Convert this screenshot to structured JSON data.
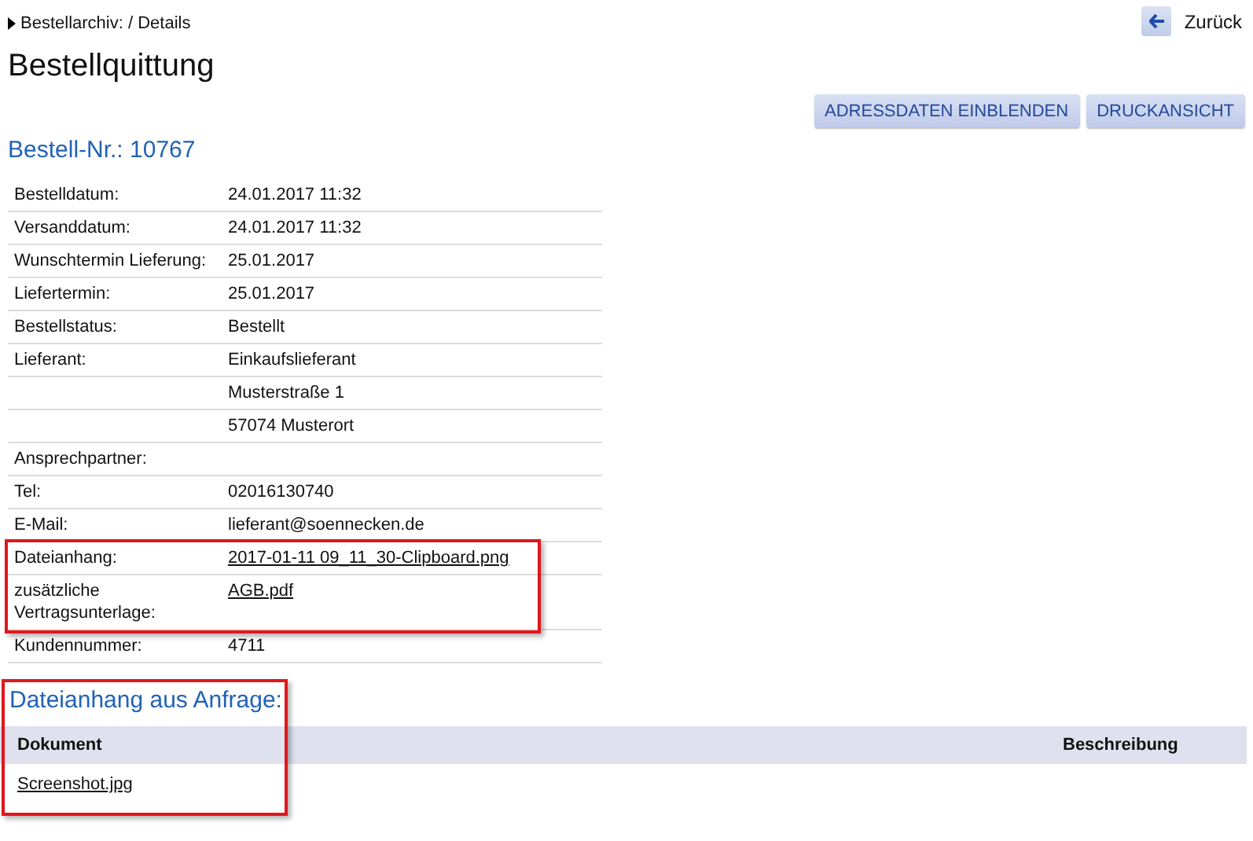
{
  "breadcrumb": "Bestellarchiv: / Details",
  "back_link": "Zurück",
  "title": "Bestellquittung",
  "buttons": [
    "ADRESSDATEN EINBLENDEN",
    "DRUCKANSICHT"
  ],
  "order_heading": "Bestell-Nr.: 10767",
  "details": [
    {
      "label": "Bestelldatum:",
      "value": "24.01.2017 11:32"
    },
    {
      "label": "Versanddatum:",
      "value": "24.01.2017 11:32"
    },
    {
      "label": "Wunschtermin Lieferung:",
      "value": "25.01.2017"
    },
    {
      "label": "Liefertermin:",
      "value": "25.01.2017"
    },
    {
      "label": "Bestellstatus:",
      "value": "Bestellt"
    },
    {
      "label": "Lieferant:",
      "value": "Einkaufslieferant"
    },
    {
      "value": "Musterstraße 1"
    },
    {
      "value": "57074 Musterort"
    },
    {
      "label": "Ansprechpartner:"
    },
    {
      "label": "Tel:",
      "value": "02016130740"
    },
    {
      "label": "E-Mail:",
      "value": "lieferant@soennecken.de"
    },
    {
      "label": "Dateianhang:",
      "value": "2017-01-11 09_11_30-Clipboard.png",
      "kind": "link",
      "highlighted": true
    },
    {
      "label": "zusätzliche Vertragsunterlage:",
      "value": "AGB.pdf",
      "kind": "link",
      "highlighted": true
    },
    {
      "label": "Kundennummer:",
      "value": "4711"
    }
  ],
  "attachments": {
    "heading": "Dateianhang aus Anfrage:",
    "highlighted": true,
    "columns": [
      "Dokument",
      "Beschreibung"
    ],
    "rows": [
      {
        "document": "Screenshot.jpg"
      }
    ]
  }
}
